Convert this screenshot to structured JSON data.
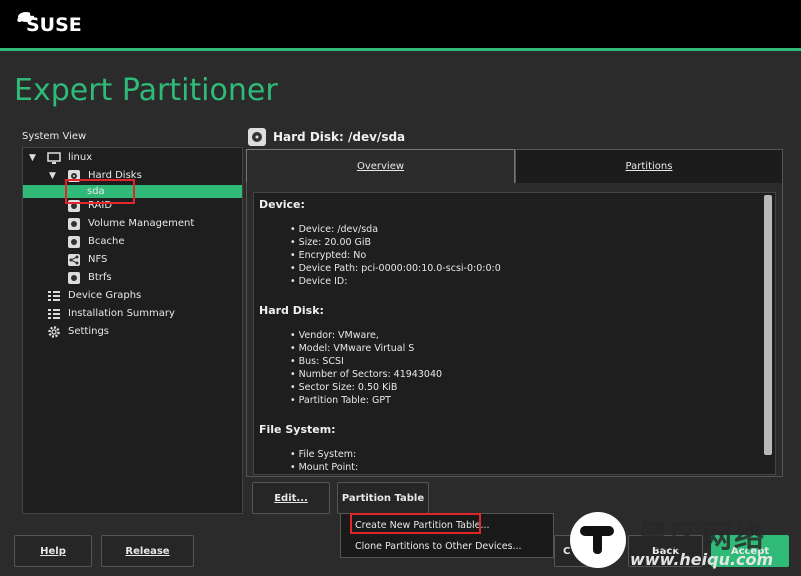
{
  "brand": {
    "name": "SUSE",
    "accent": "#30ba78",
    "highlight": "#e0262c"
  },
  "page_title": "Expert Partitioner",
  "system_view": {
    "label": "System View",
    "items": [
      {
        "label": "linux",
        "icon": "monitor-icon"
      },
      {
        "label": "Hard Disks",
        "icon": "hard-disk-icon"
      },
      {
        "label": "sda",
        "icon": ""
      },
      {
        "label": "RAID",
        "icon": "raid-icon"
      },
      {
        "label": "Volume Management",
        "icon": "volume-icon"
      },
      {
        "label": "Bcache",
        "icon": "bcache-icon"
      },
      {
        "label": "NFS",
        "icon": "nfs-icon"
      },
      {
        "label": "Btrfs",
        "icon": "btrfs-icon"
      },
      {
        "label": "Device Graphs",
        "icon": "graph-icon"
      },
      {
        "label": "Installation Summary",
        "icon": "list-icon"
      },
      {
        "label": "Settings",
        "icon": "gear-icon"
      }
    ]
  },
  "detail": {
    "header": "Hard Disk: /dev/sda",
    "tabs": [
      {
        "label": "Overview"
      },
      {
        "label": "Partitions"
      }
    ],
    "sections": [
      {
        "title": "Device:",
        "lines": [
          "Device: /dev/sda",
          "Size: 20.00 GiB",
          "Encrypted: No",
          "Device Path: pci-0000:00:10.0-scsi-0:0:0:0",
          "Device ID:"
        ]
      },
      {
        "title": "Hard Disk:",
        "lines": [
          "Vendor: VMware,",
          "Model: VMware Virtual S",
          "Bus: SCSI",
          "Number of Sectors: 41943040",
          "Sector Size: 0.50 KiB",
          "Partition Table: GPT"
        ]
      },
      {
        "title": "File System:",
        "lines": [
          "File System:",
          "Mount Point:"
        ]
      }
    ]
  },
  "buttons": {
    "edit": "Edit...",
    "partition_table": "Partition Table",
    "help": "Help",
    "release_notes": "Release Notes...",
    "cancel_partial": "C",
    "back": "Back",
    "accept": "Accept"
  },
  "partition_menu": {
    "items": [
      "Create New Partition Table...",
      "Clone Partitions to Other Devices..."
    ]
  },
  "watermark": {
    "chars": "黑区网络",
    "url": "www.heiqu.com"
  }
}
